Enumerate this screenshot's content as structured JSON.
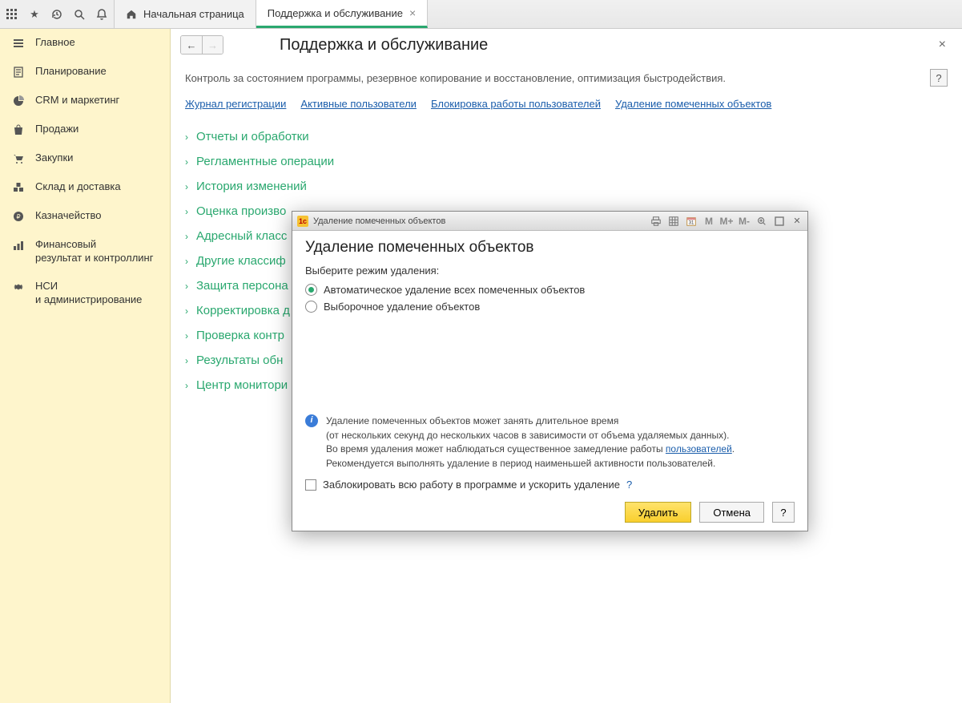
{
  "tabs": {
    "home": "Начальная страница",
    "support": "Поддержка и обслуживание"
  },
  "sidebar": {
    "items": [
      {
        "label": "Главное"
      },
      {
        "label": "Планирование"
      },
      {
        "label": "CRM и маркетинг"
      },
      {
        "label": "Продажи"
      },
      {
        "label": "Закупки"
      },
      {
        "label": "Склад и доставка"
      },
      {
        "label": "Казначейство"
      },
      {
        "label": "Финансовый\nрезультат и контроллинг"
      },
      {
        "label": "НСИ\nи администрирование"
      }
    ]
  },
  "page": {
    "title": "Поддержка и обслуживание",
    "desc": "Контроль за состоянием программы, резервное копирование и восстановление, оптимизация быстродействия.",
    "help": "?",
    "links": [
      "Журнал регистрации",
      "Активные пользователи",
      "Блокировка работы пользователей",
      "Удаление помеченных объектов"
    ],
    "sections": [
      "Отчеты и обработки",
      "Регламентные операции",
      "История изменений",
      "Оценка произво",
      "Адресный класс",
      "Другие классиф",
      "Защита персона",
      "Корректировка д",
      "Проверка контр",
      "Результаты обн",
      "Центр монитори"
    ]
  },
  "dialog": {
    "titlebar": "Удаление помеченных объектов",
    "tb_m": "M",
    "tb_mplus": "M+",
    "tb_mminus": "M-",
    "heading": "Удаление помеченных объектов",
    "mode_label": "Выберите режим удаления:",
    "radio_auto": "Автоматическое удаление всех помеченных объектов",
    "radio_select": "Выборочное удаление объектов",
    "info_line1": "Удаление помеченных объектов может занять длительное время",
    "info_line2a": "(от нескольких секунд до нескольких часов в зависимости от объема удаляемых данных).",
    "info_line3a": "Во время удаления может наблюдаться существенное замедление работы ",
    "info_users_link": "пользователей",
    "info_line3b": ".",
    "info_line4": "Рекомендуется выполнять удаление в период наименьшей активности пользователей.",
    "checkbox_label": "Заблокировать всю работу в программе и ускорить удаление",
    "q": "?",
    "btn_delete": "Удалить",
    "btn_cancel": "Отмена",
    "btn_help": "?"
  }
}
